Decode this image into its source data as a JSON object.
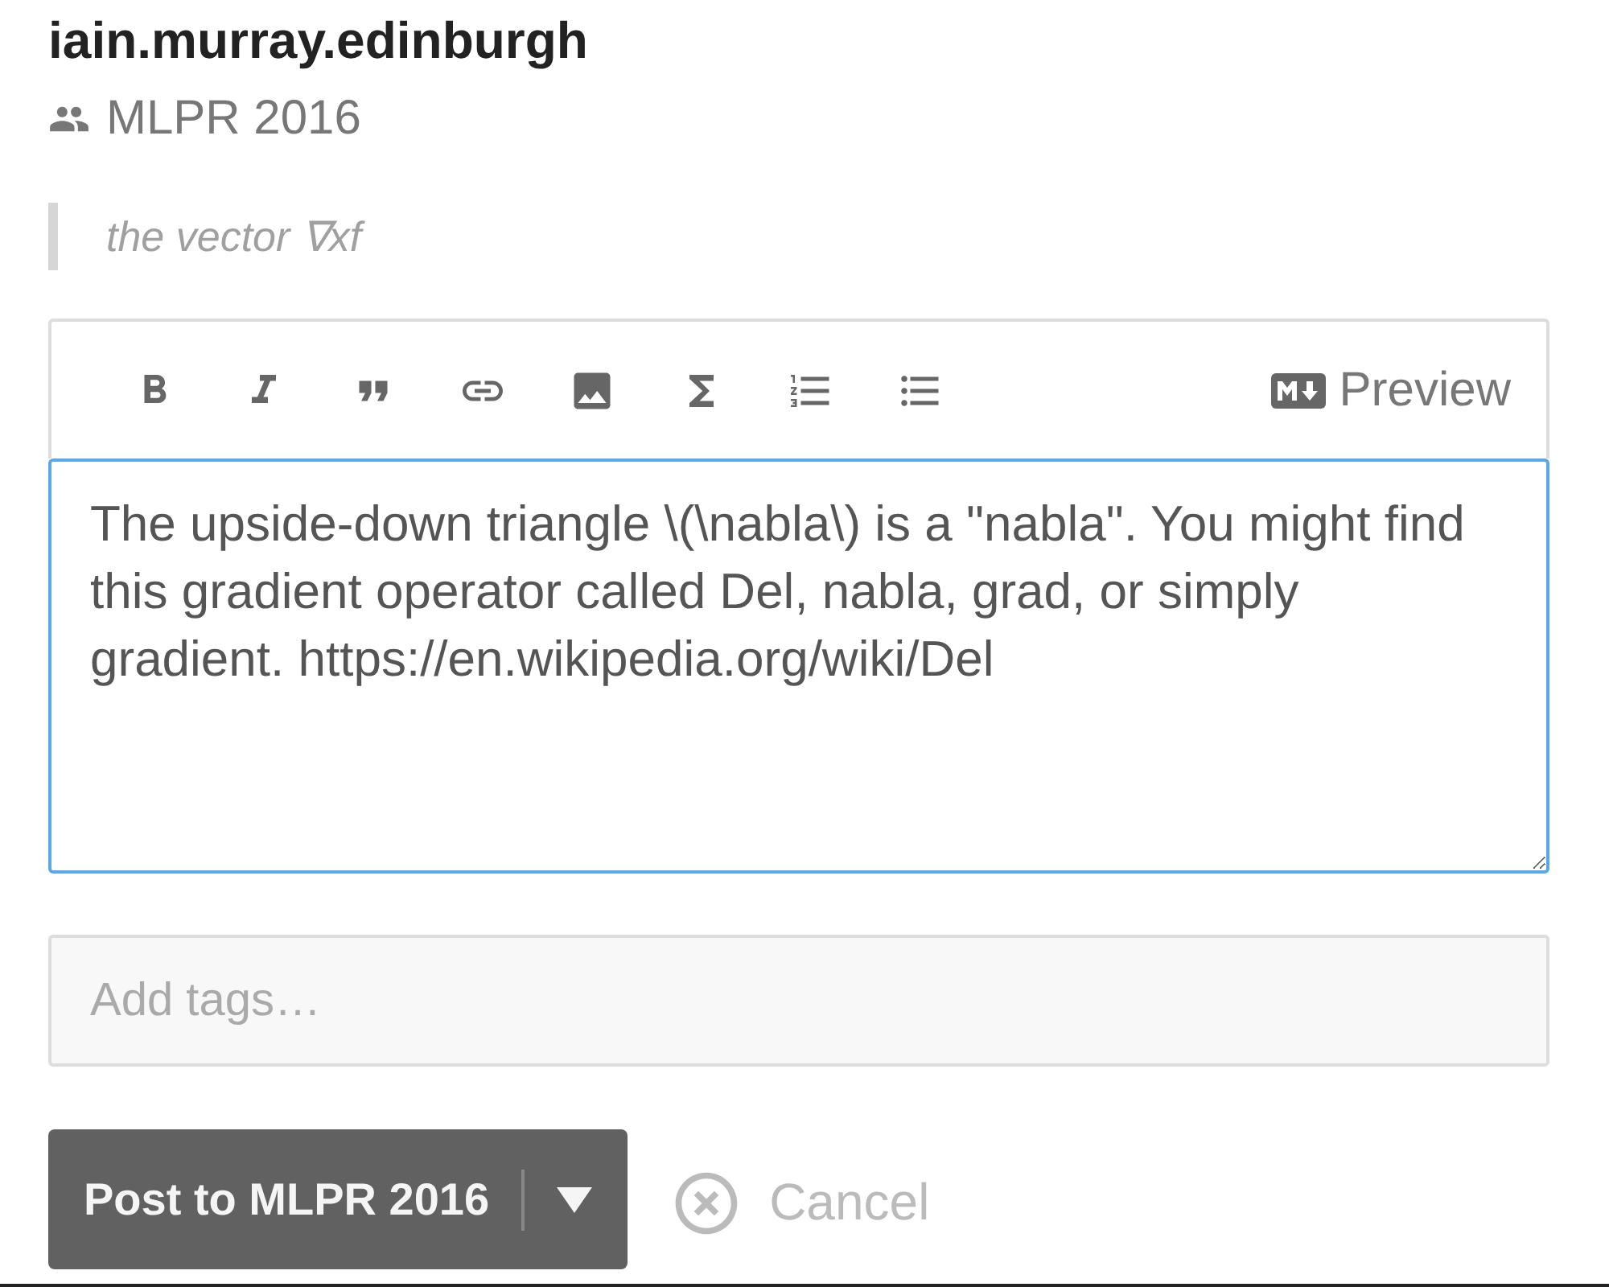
{
  "author": "iain.murray.edinburgh",
  "group": "MLPR 2016",
  "quote": "the vector ∇xf",
  "toolbar": [
    {
      "kind": "bold"
    },
    {
      "kind": "italic"
    },
    {
      "kind": "quote"
    },
    {
      "kind": "link"
    },
    {
      "kind": "image"
    },
    {
      "kind": "math"
    },
    {
      "kind": "ordered-list"
    },
    {
      "kind": "bullet-list"
    }
  ],
  "preview": "Preview",
  "editor": {
    "value": "The upside-down triangle \\(\\nabla\\) is a \"nabla\". You might find this gradient operator called Del, nabla, grad, or simply gradient. https://en.wikipedia.org/wiki/Del"
  },
  "tags": {
    "placeholder": "Add tags…"
  },
  "post_button": "Post to MLPR 2016",
  "cancel": "Cancel"
}
